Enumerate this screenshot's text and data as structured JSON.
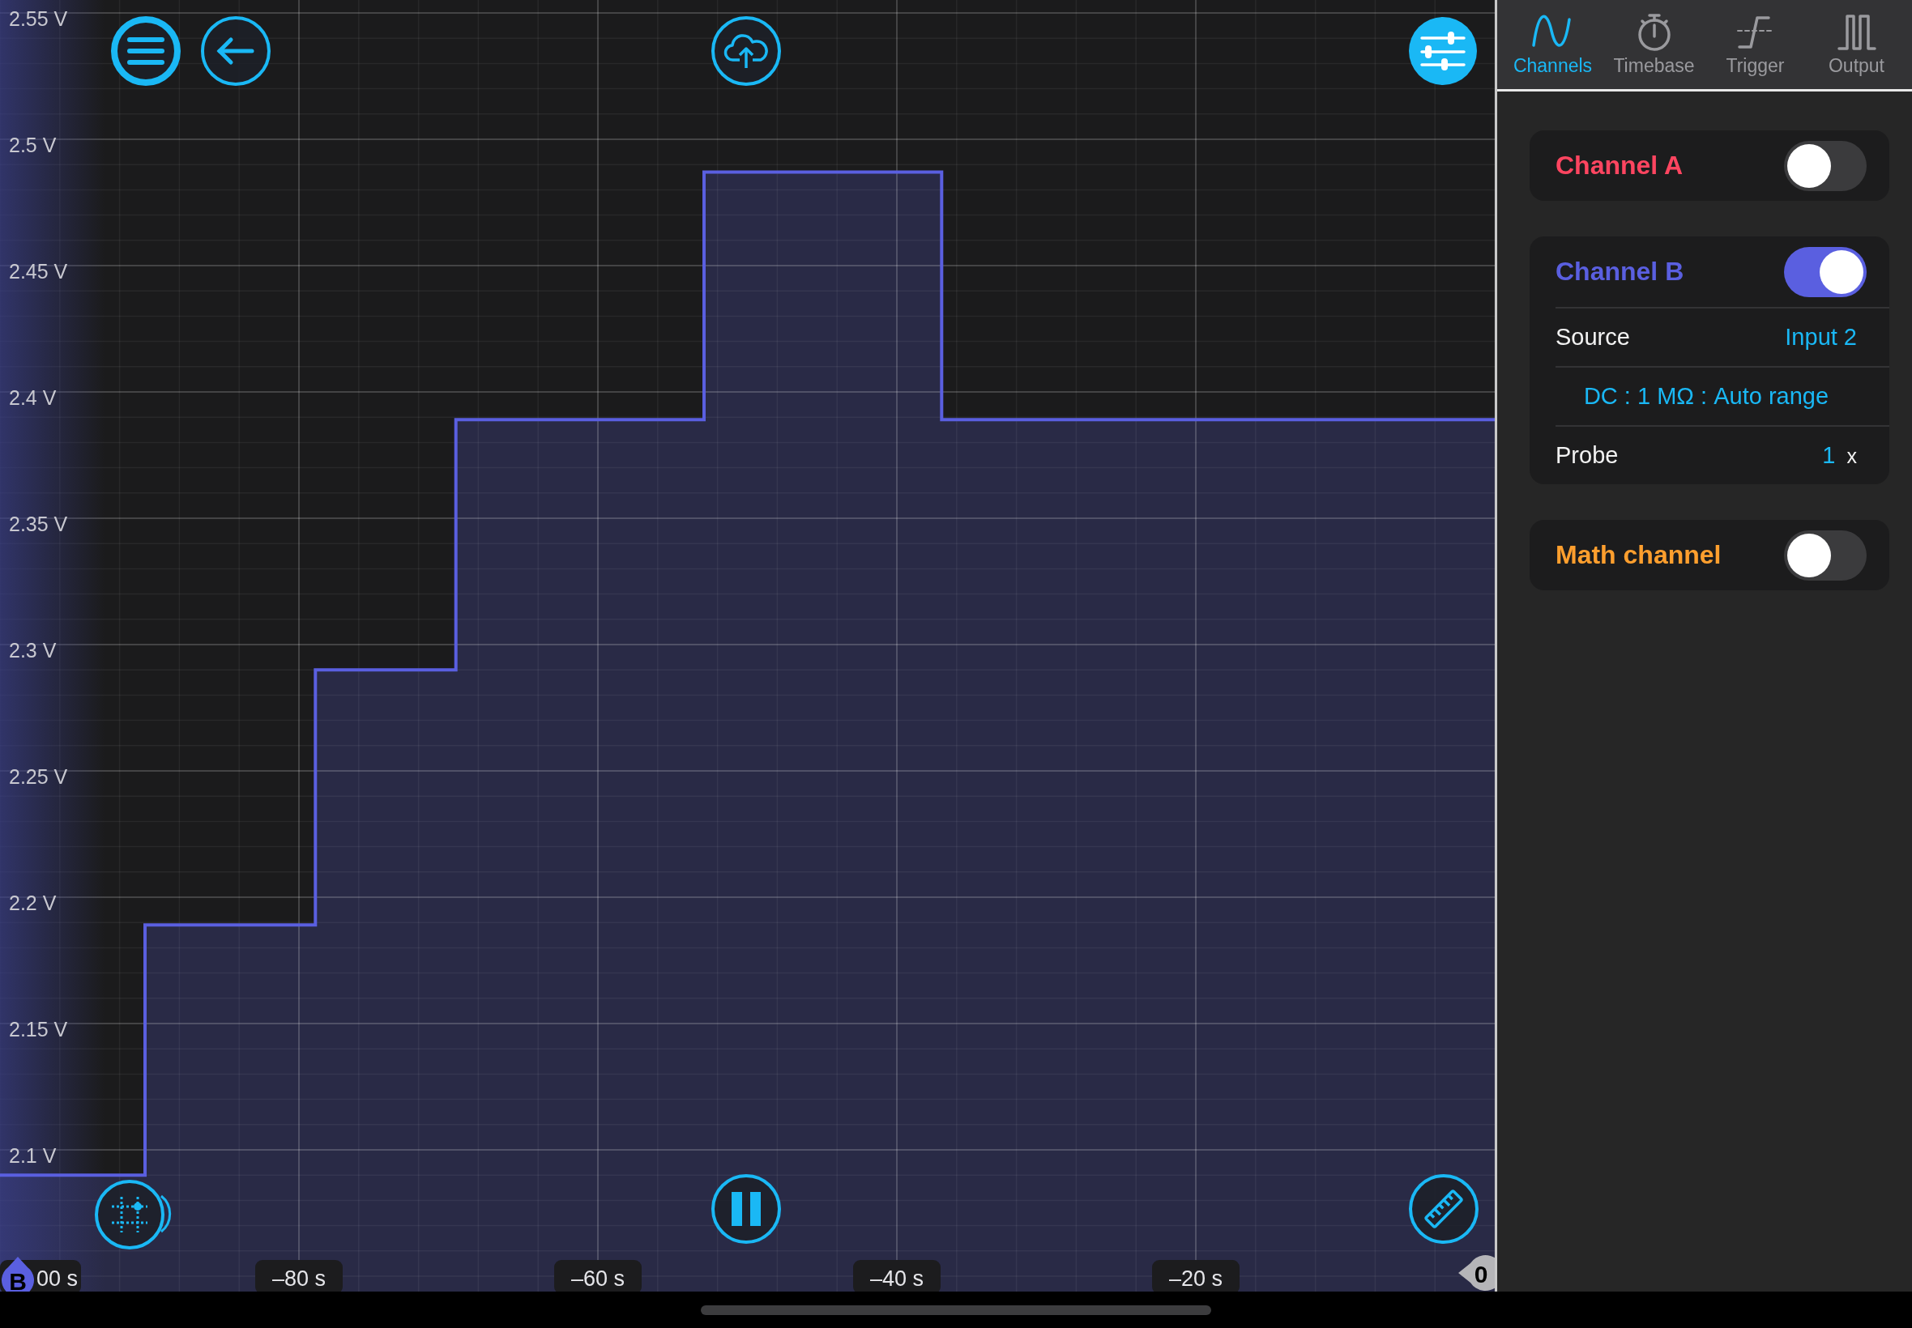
{
  "scope": {
    "chart_data": {
      "type": "area",
      "xlim": [
        -100,
        0
      ],
      "ylim": [
        2.044,
        2.55
      ],
      "grid": true,
      "xticks": [
        {
          "value": -80,
          "label": "–80 s"
        },
        {
          "value": -60,
          "label": "–60 s"
        },
        {
          "value": -40,
          "label": "–40 s"
        },
        {
          "value": -20,
          "label": "–20 s"
        }
      ],
      "yticks": [
        {
          "value": 2.55,
          "label": "2.55 V"
        },
        {
          "value": 2.5,
          "label": "2.5 V"
        },
        {
          "value": 2.45,
          "label": "2.45 V"
        },
        {
          "value": 2.4,
          "label": "2.4 V"
        },
        {
          "value": 2.35,
          "label": "2.35 V"
        },
        {
          "value": 2.3,
          "label": "2.3 V"
        },
        {
          "value": 2.25,
          "label": "2.25 V"
        },
        {
          "value": 2.2,
          "label": "2.2 V"
        },
        {
          "value": 2.15,
          "label": "2.15 V"
        },
        {
          "value": 2.1,
          "label": "2.1 V"
        }
      ],
      "x": [
        -100,
        -90.3,
        -90.3,
        -78.9,
        -78.9,
        -69.5,
        -69.5,
        -52.9,
        -52.9,
        -37.0,
        -37.0,
        0
      ],
      "series": [
        {
          "color": "#5a5fe0",
          "values": [
            2.09,
            2.09,
            2.189,
            2.189,
            2.29,
            2.29,
            2.389,
            2.389,
            2.487,
            2.487,
            2.389,
            2.389
          ]
        }
      ]
    },
    "trace_marker": "B",
    "cut_tick_label": "00 s",
    "offset_marker": "0"
  },
  "panel": {
    "tabs": [
      {
        "label": "Channels",
        "selected": true
      },
      {
        "label": "Timebase",
        "selected": false
      },
      {
        "label": "Trigger",
        "selected": false
      },
      {
        "label": "Output",
        "selected": false
      }
    ],
    "channels": [
      {
        "name": "Channel A",
        "color": "#ff4560",
        "on": false
      },
      {
        "name": "Channel B",
        "color": "#5a5fe0",
        "on": true,
        "rows": [
          {
            "kind": "pair",
            "label": "Source",
            "value": "Input 2"
          },
          {
            "kind": "center",
            "value": "DC : 1 MΩ : Auto range"
          },
          {
            "kind": "probe",
            "label": "Probe",
            "value": "1",
            "unit": "x"
          }
        ]
      },
      {
        "name": "Math channel",
        "color": "#ff9f2e",
        "on": false
      }
    ]
  }
}
